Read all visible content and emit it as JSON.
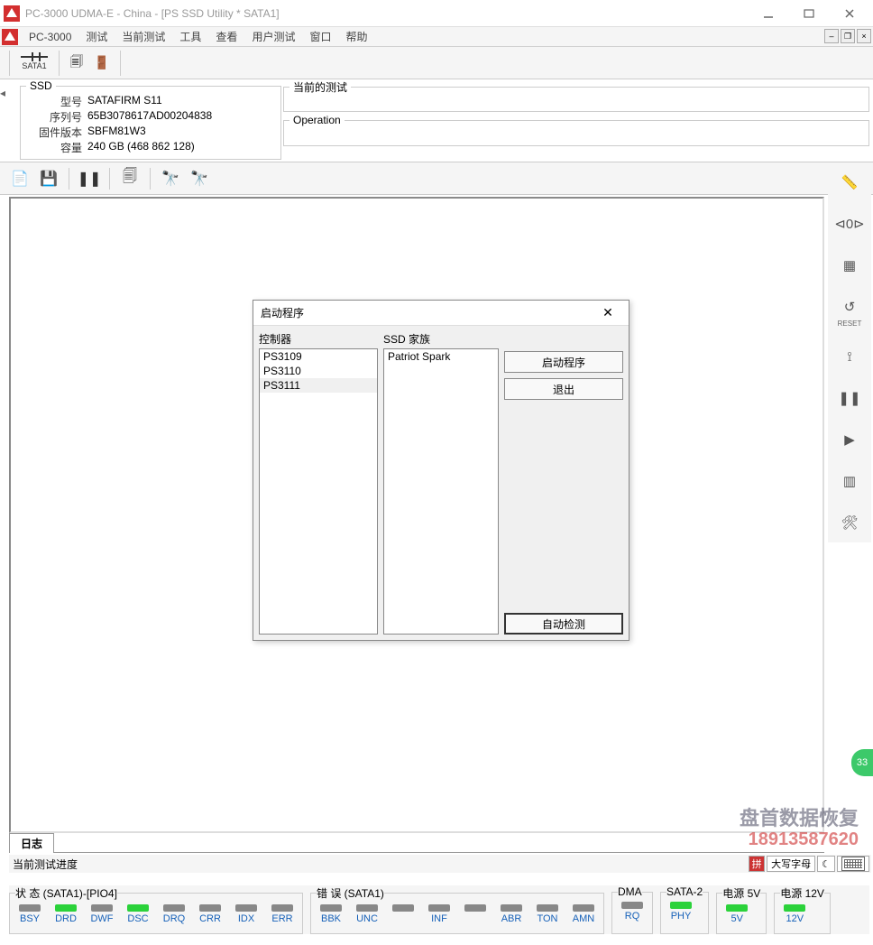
{
  "titlebar": {
    "title": "PC-3000 UDMA-E - China - [PS SSD Utility * SATA1]"
  },
  "menubar": {
    "items": [
      "PC-3000",
      "测试",
      "当前测试",
      "工具",
      "查看",
      "用户测试",
      "窗口",
      "帮助"
    ]
  },
  "toolbar1": {
    "sata_label": "SATA1"
  },
  "ssd": {
    "legend": "SSD",
    "rows": [
      {
        "label": "型号",
        "value": "SATAFIRM   S11"
      },
      {
        "label": "序列号",
        "value": "65B3078617AD00204838"
      },
      {
        "label": "固件版本",
        "value": "SBFM81W3"
      },
      {
        "label": "容量",
        "value": "240 GB (468 862 128)"
      }
    ]
  },
  "panels": {
    "current_test": "当前的测试",
    "operation": "Operation"
  },
  "dialog": {
    "title": "启动程序",
    "controller_label": "控制器",
    "families_label": "SSD 家族",
    "controllers": [
      "PS3109",
      "PS3110",
      "PS3111"
    ],
    "selected_controller": "PS3111",
    "families": [
      "Patriot Spark"
    ],
    "start_btn": "启动程序",
    "exit_btn": "退出",
    "auto_btn": "自动检测"
  },
  "log_tab": "日志",
  "progress_label": "当前测试进度",
  "ime": {
    "label": "大写字母"
  },
  "status": {
    "group1": {
      "title": "状 态 (SATA1)-[PIO4]",
      "leds": [
        {
          "label": "BSY",
          "on": false
        },
        {
          "label": "DRD",
          "on": true
        },
        {
          "label": "DWF",
          "on": false
        },
        {
          "label": "DSC",
          "on": true
        },
        {
          "label": "DRQ",
          "on": false
        },
        {
          "label": "CRR",
          "on": false
        },
        {
          "label": "IDX",
          "on": false
        },
        {
          "label": "ERR",
          "on": false
        }
      ]
    },
    "group2": {
      "title": "错 误 (SATA1)",
      "leds": [
        {
          "label": "BBK",
          "on": false
        },
        {
          "label": "UNC",
          "on": false
        },
        {
          "label": "",
          "on": false
        },
        {
          "label": "INF",
          "on": false
        },
        {
          "label": "",
          "on": false
        },
        {
          "label": "ABR",
          "on": false
        },
        {
          "label": "TON",
          "on": false
        },
        {
          "label": "AMN",
          "on": false
        }
      ]
    },
    "group3": {
      "title": "DMA",
      "leds": [
        {
          "label": "RQ",
          "on": false
        }
      ]
    },
    "group4": {
      "title": "SATA-2",
      "leds": [
        {
          "label": "PHY",
          "on": true
        }
      ]
    },
    "group5": {
      "title": "电源 5V",
      "leds": [
        {
          "label": "5V",
          "on": true
        }
      ]
    },
    "group6": {
      "title": "电源 12V",
      "leds": [
        {
          "label": "12V",
          "on": true
        }
      ]
    }
  },
  "watermark": {
    "line1": "盘首数据恢复",
    "phone": "18913587620"
  },
  "green_badge": "33"
}
